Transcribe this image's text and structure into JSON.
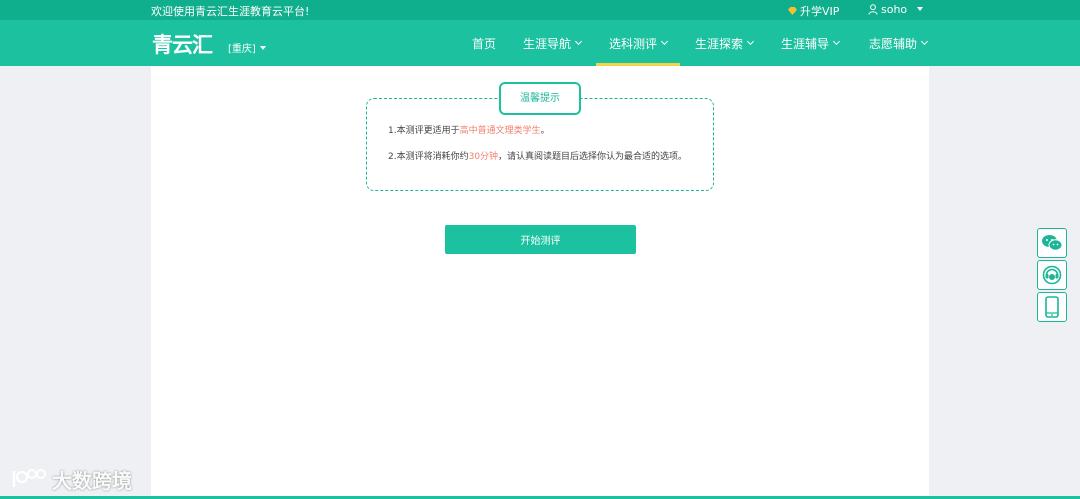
{
  "topbar": {
    "welcome": "欢迎使用青云汇生涯教育云平台!",
    "vip_label": "升学VIP",
    "username": "soho"
  },
  "navbar": {
    "logo": "青云汇",
    "city": "[重庆]",
    "items": [
      {
        "label": "首页"
      },
      {
        "label": "生涯导航"
      },
      {
        "label": "选科测评"
      },
      {
        "label": "生涯探索"
      },
      {
        "label": "生涯辅导"
      },
      {
        "label": "志愿辅助"
      }
    ]
  },
  "tips": {
    "title": "温馨提示",
    "line1": {
      "prefix": "1.本测评更适用于",
      "highlight": "高中普通文理类学生",
      "suffix": "。"
    },
    "line2": {
      "prefix": "2.本测评将消耗你约",
      "highlight": "30分钟",
      "suffix": "，请认真阅读题目后选择你认为最合适的选项。"
    }
  },
  "start_button": "开始测评",
  "watermark": "大数跨境",
  "colors": {
    "primary": "#1cc29f",
    "topbar": "#0fae8c",
    "highlight": "#f0806e",
    "active_underline": "#f4d24a"
  }
}
